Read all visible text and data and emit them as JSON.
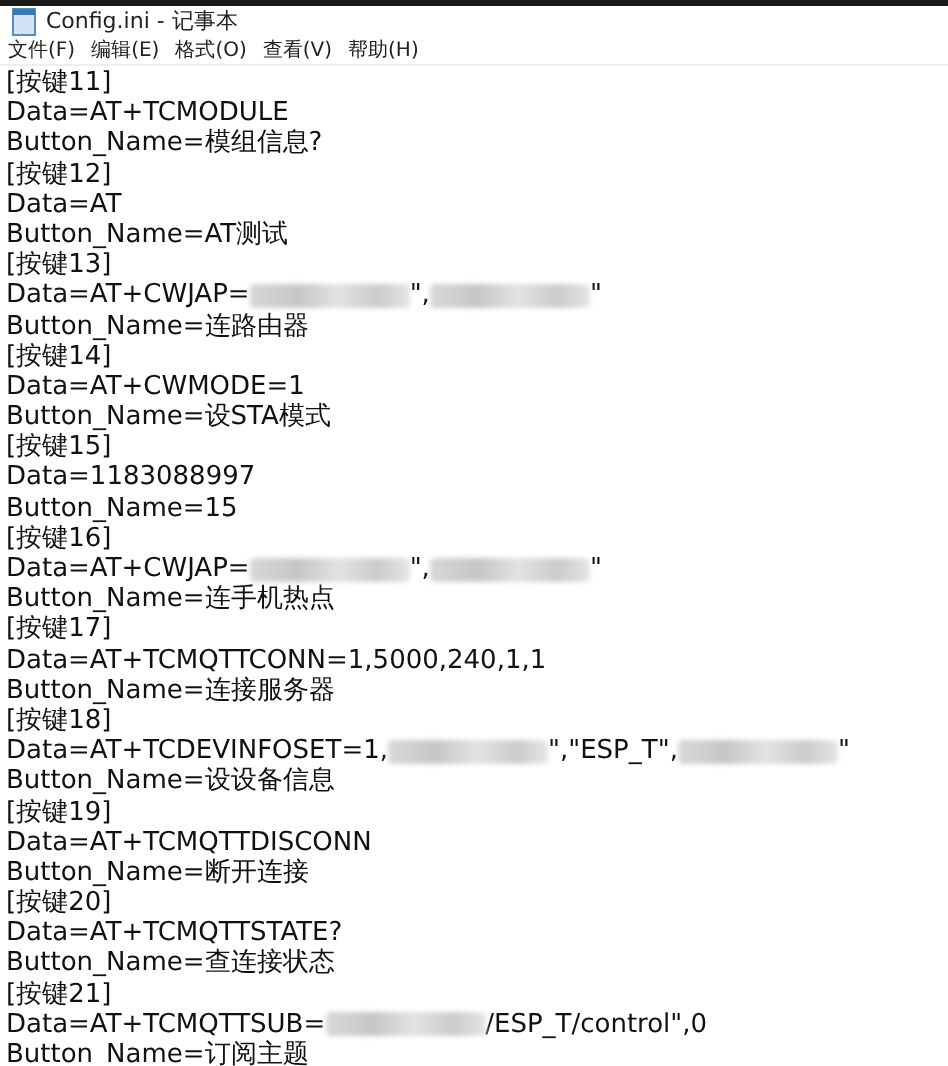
{
  "window": {
    "title": "Config.ini - 记事本"
  },
  "menu": [
    {
      "label": "文件(F)"
    },
    {
      "label": "编辑(E)"
    },
    {
      "label": "格式(O)"
    },
    {
      "label": "查看(V)"
    },
    {
      "label": "帮助(H)"
    }
  ],
  "lines": [
    [
      {
        "kind": "text",
        "text": "[按键11]"
      }
    ],
    [
      {
        "kind": "text",
        "text": "Data=AT+TCMODULE"
      }
    ],
    [
      {
        "kind": "text",
        "text": "Button_Name=模组信息?"
      }
    ],
    [
      {
        "kind": "text",
        "text": "[按键12]"
      }
    ],
    [
      {
        "kind": "text",
        "text": "Data=AT"
      }
    ],
    [
      {
        "kind": "text",
        "text": "Button_Name=AT测试"
      }
    ],
    [
      {
        "kind": "text",
        "text": "[按键13]"
      }
    ],
    [
      {
        "kind": "text",
        "text": "Data=AT+CWJAP="
      },
      {
        "kind": "redacted"
      },
      {
        "kind": "text",
        "text": "\","
      },
      {
        "kind": "redacted"
      },
      {
        "kind": "text",
        "text": "\""
      }
    ],
    [
      {
        "kind": "text",
        "text": "Button_Name=连路由器"
      }
    ],
    [
      {
        "kind": "text",
        "text": "[按键14]"
      }
    ],
    [
      {
        "kind": "text",
        "text": "Data=AT+CWMODE=1"
      }
    ],
    [
      {
        "kind": "text",
        "text": "Button_Name=设STA模式"
      }
    ],
    [
      {
        "kind": "text",
        "text": "[按键15]"
      }
    ],
    [
      {
        "kind": "text",
        "text": "Data=1183088997"
      }
    ],
    [
      {
        "kind": "text",
        "text": "Button_Name=15"
      }
    ],
    [
      {
        "kind": "text",
        "text": "[按键16]"
      }
    ],
    [
      {
        "kind": "text",
        "text": "Data=AT+CWJAP="
      },
      {
        "kind": "redacted"
      },
      {
        "kind": "text",
        "text": "\","
      },
      {
        "kind": "redacted"
      },
      {
        "kind": "text",
        "text": "\""
      }
    ],
    [
      {
        "kind": "text",
        "text": "Button_Name=连手机热点"
      }
    ],
    [
      {
        "kind": "text",
        "text": "[按键17]"
      }
    ],
    [
      {
        "kind": "text",
        "text": "Data=AT+TCMQTTCONN=1,5000,240,1,1"
      }
    ],
    [
      {
        "kind": "text",
        "text": "Button_Name=连接服务器"
      }
    ],
    [
      {
        "kind": "text",
        "text": "[按键18]"
      }
    ],
    [
      {
        "kind": "text",
        "text": "Data=AT+TCDEVINFOSET=1,"
      },
      {
        "kind": "redacted"
      },
      {
        "kind": "text",
        "text": "\",\"ESP_T\","
      },
      {
        "kind": "redacted"
      },
      {
        "kind": "text",
        "text": "\""
      }
    ],
    [
      {
        "kind": "text",
        "text": "Button_Name=设设备信息"
      }
    ],
    [
      {
        "kind": "text",
        "text": "[按键19]"
      }
    ],
    [
      {
        "kind": "text",
        "text": "Data=AT+TCMQTTDISCONN"
      }
    ],
    [
      {
        "kind": "text",
        "text": "Button_Name=断开连接"
      }
    ],
    [
      {
        "kind": "text",
        "text": "[按键20]"
      }
    ],
    [
      {
        "kind": "text",
        "text": "Data=AT+TCMQTTSTATE?"
      }
    ],
    [
      {
        "kind": "text",
        "text": "Button_Name=查连接状态"
      }
    ],
    [
      {
        "kind": "text",
        "text": "[按键21]"
      }
    ],
    [
      {
        "kind": "text",
        "text": "Data=AT+TCMQTTSUB="
      },
      {
        "kind": "redacted"
      },
      {
        "kind": "text",
        "text": "/ESP_T/control\",0"
      }
    ],
    [
      {
        "kind": "text",
        "text": "Button_Name=订阅主题"
      }
    ]
  ]
}
